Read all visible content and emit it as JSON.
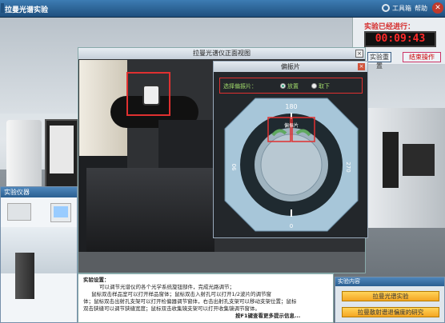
{
  "app": {
    "title": "拉曼光谱实验"
  },
  "topbar": {
    "toolbox": "工具箱",
    "help": "帮助"
  },
  "timer": {
    "label": "实验已经进行：",
    "value": "00:09:43"
  },
  "timer_panel": {
    "restart_btn": "实验重置",
    "end_btn": "结束操作"
  },
  "devices": {
    "header": "实验仪器"
  },
  "front_view": {
    "title": "拉曼光谱仪正面视图"
  },
  "polarizer": {
    "title": "偏振片",
    "select_label": "选择偏振片：",
    "option_place": "放置",
    "option_remove": "取下",
    "dial_180": "180",
    "dial_90": "90",
    "dial_270": "270",
    "dial_0": "0",
    "dial_center": "偏振片"
  },
  "instructions": {
    "heading": "实验设置：",
    "line1": "可以调节光谱仪的各个光学系统旋钮部件，完成光路调节；",
    "line2": "鼠标双击样品室可以打开样品窗体；鼠标双击入射孔可以打开1/2波片的调节窗",
    "line3": "体；鼠标双击出射孔支架可以打开检偏器调节窗体，右击出射孔支架可以移动支架位置；鼠标",
    "line4": "双击狭缝可以调节狭缝宽度；鼠标双击收集镜支架可以打开收集镜调节窗体。",
    "line5": "按F1键查看更多提示信息..."
  },
  "experiments": {
    "header": "实验内容",
    "items": [
      "拉曼光谱实验",
      "拉曼散射谱退偏度的研究"
    ]
  },
  "colors": {
    "accent_red": "#e03030",
    "timer_red": "#ff2a2a",
    "btn_orange": "#f5a623"
  }
}
